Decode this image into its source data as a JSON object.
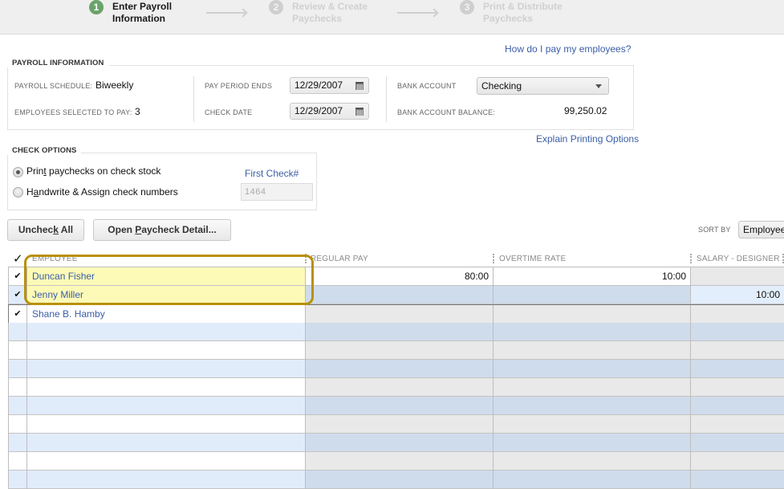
{
  "steps": [
    {
      "number": "1",
      "line1": "Enter Payroll",
      "line2": "Information",
      "state": "active"
    },
    {
      "number": "2",
      "line1": "Review & Create",
      "line2": "Paychecks",
      "state": "inactive"
    },
    {
      "number": "3",
      "line1": "Print & Distribute",
      "line2": "Paychecks",
      "state": "inactive"
    }
  ],
  "help_link": "How do I pay my employees?",
  "payroll_info": {
    "legend": "PAYROLL INFORMATION",
    "schedule_label": "PAYROLL SCHEDULE:",
    "schedule_value": "Biweekly",
    "employees_label": "EMPLOYEES SELECTED TO PAY:",
    "employees_value": "3",
    "pay_period_label": "PAY PERIOD ENDS",
    "pay_period_value": "12/29/2007",
    "check_date_label": "CHECK DATE",
    "check_date_value": "12/29/2007",
    "bank_account_label": "BANK ACCOUNT",
    "bank_account_value": "Checking",
    "balance_label": "BANK ACCOUNT BALANCE:",
    "balance_value": "99,250.02"
  },
  "explain_link": "Explain Printing Options",
  "check_options": {
    "legend": "CHECK OPTIONS",
    "option1_pre": "Prin",
    "option1_u": "t",
    "option1_post": " paychecks on check stock",
    "option1_selected": true,
    "option2_pre": "H",
    "option2_u": "a",
    "option2_post": "ndwrite & Assign check numbers",
    "option2_selected": false,
    "first_check_label": "First Check#",
    "first_check_value": "1464"
  },
  "buttons": {
    "uncheck_pre": "Unchec",
    "uncheck_u": "k",
    "uncheck_post": " All",
    "open_pre": "Open ",
    "open_u": "P",
    "open_post": "aycheck Detail..."
  },
  "sort": {
    "label": "SORT BY",
    "value": "Employees"
  },
  "grid": {
    "check_header": "✓",
    "columns": [
      "EMPLOYEE",
      "REGULAR PAY",
      "OVERTIME RATE",
      "SALARY - DESIGNER"
    ],
    "rows": [
      {
        "checked": true,
        "employee": "Duncan Fisher",
        "regular_pay": "80:00",
        "overtime_rate": "10:00",
        "salary_designer": ""
      },
      {
        "checked": true,
        "employee": "Jenny Miller",
        "regular_pay": "",
        "overtime_rate": "",
        "salary_designer": "10:00"
      },
      {
        "checked": true,
        "employee": "Shane B. Hamby",
        "regular_pay": "",
        "overtime_rate": "",
        "salary_designer": ""
      }
    ],
    "highlight_color": "#b8900a"
  },
  "colors": {
    "accent_link": "#3a5ea8",
    "step_active": "#6aa36a",
    "row_alt": "#e1ecfb",
    "highlight_fill": "#fdfab8"
  }
}
